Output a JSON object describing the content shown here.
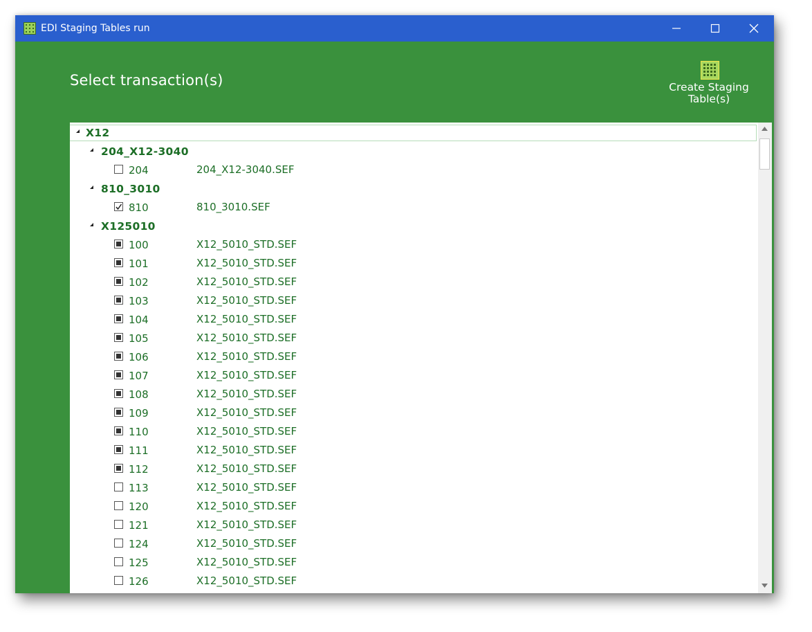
{
  "window": {
    "title": "EDI Staging Tables run"
  },
  "header": {
    "title": "Select transaction(s)",
    "create_button": "Create Staging Table(s)"
  },
  "tree": {
    "root": "X12",
    "groups": [
      {
        "name": "204_X12-3040",
        "items": [
          {
            "code": "204",
            "file": "204_X12-3040.SEF",
            "state": "unchecked"
          }
        ]
      },
      {
        "name": "810_3010",
        "items": [
          {
            "code": "810",
            "file": "810_3010.SEF",
            "state": "checked"
          }
        ]
      },
      {
        "name": "X125010",
        "items": [
          {
            "code": "100",
            "file": "X12_5010_STD.SEF",
            "state": "partial"
          },
          {
            "code": "101",
            "file": "X12_5010_STD.SEF",
            "state": "partial"
          },
          {
            "code": "102",
            "file": "X12_5010_STD.SEF",
            "state": "partial"
          },
          {
            "code": "103",
            "file": "X12_5010_STD.SEF",
            "state": "partial"
          },
          {
            "code": "104",
            "file": "X12_5010_STD.SEF",
            "state": "partial"
          },
          {
            "code": "105",
            "file": "X12_5010_STD.SEF",
            "state": "partial"
          },
          {
            "code": "106",
            "file": "X12_5010_STD.SEF",
            "state": "partial"
          },
          {
            "code": "107",
            "file": "X12_5010_STD.SEF",
            "state": "partial"
          },
          {
            "code": "108",
            "file": "X12_5010_STD.SEF",
            "state": "partial"
          },
          {
            "code": "109",
            "file": "X12_5010_STD.SEF",
            "state": "partial"
          },
          {
            "code": "110",
            "file": "X12_5010_STD.SEF",
            "state": "partial"
          },
          {
            "code": "111",
            "file": "X12_5010_STD.SEF",
            "state": "partial"
          },
          {
            "code": "112",
            "file": "X12_5010_STD.SEF",
            "state": "partial"
          },
          {
            "code": "113",
            "file": "X12_5010_STD.SEF",
            "state": "unchecked"
          },
          {
            "code": "120",
            "file": "X12_5010_STD.SEF",
            "state": "unchecked"
          },
          {
            "code": "121",
            "file": "X12_5010_STD.SEF",
            "state": "unchecked"
          },
          {
            "code": "124",
            "file": "X12_5010_STD.SEF",
            "state": "unchecked"
          },
          {
            "code": "125",
            "file": "X12_5010_STD.SEF",
            "state": "unchecked"
          },
          {
            "code": "126",
            "file": "X12_5010_STD.SEF",
            "state": "unchecked"
          }
        ]
      }
    ]
  },
  "colors": {
    "titlebar": "#2a5fce",
    "background": "#3a913d",
    "text_green": "#1c6e26"
  },
  "icons": {
    "app": "grid-table-icon",
    "create": "grid-table-icon"
  }
}
